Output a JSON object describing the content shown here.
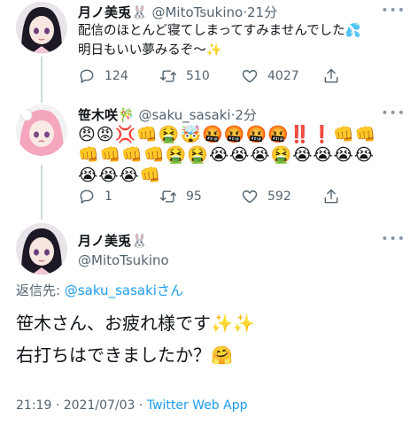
{
  "tweet1": {
    "name": "月ノ美兎",
    "name_badge": "🐰",
    "handle": "@MitoTsukino",
    "time": "21分",
    "line1": "配信のほとんど寝てしまってすみませんでした💦",
    "line2": "明日もいい夢みるぞ〜✨",
    "replies": "124",
    "retweets": "510",
    "likes": "4027"
  },
  "tweet2": {
    "name": "笹木咲",
    "name_badge": "🎋",
    "handle": "@saku_sasaki",
    "time": "2分",
    "emoji_line1": "😠😡💢👊🤮🤯🤬🤬🤬🤬‼️❗️👊👊",
    "emoji_line2": "👊👊👊👊🤮🤮😭😭😭🤮😭😭😭😭",
    "emoji_line3": "😭😭😭👊",
    "replies": "1",
    "retweets": "95",
    "likes": "592"
  },
  "tweet3": {
    "name": "月ノ美兎",
    "name_badge": "🐰",
    "handle": "@MitoTsukino",
    "reply_prefix": "返信先: ",
    "reply_handle": "@saku_sasaki",
    "reply_suffix": "さん",
    "line1": "笹木さん、お疲れ様です✨✨",
    "line2": "右打ちはできましたか？🤗",
    "time": "21:19",
    "date": "2021/07/03",
    "source": "Twitter Web App"
  },
  "separator": "·",
  "more_glyph": "•••",
  "icons": [
    "reply-icon",
    "retweet-icon",
    "like-icon",
    "share-icon",
    "more-icon"
  ],
  "colors": {
    "link": "#1d9bf0",
    "secondary": "#536471",
    "thread_line": "#cfd9de"
  }
}
